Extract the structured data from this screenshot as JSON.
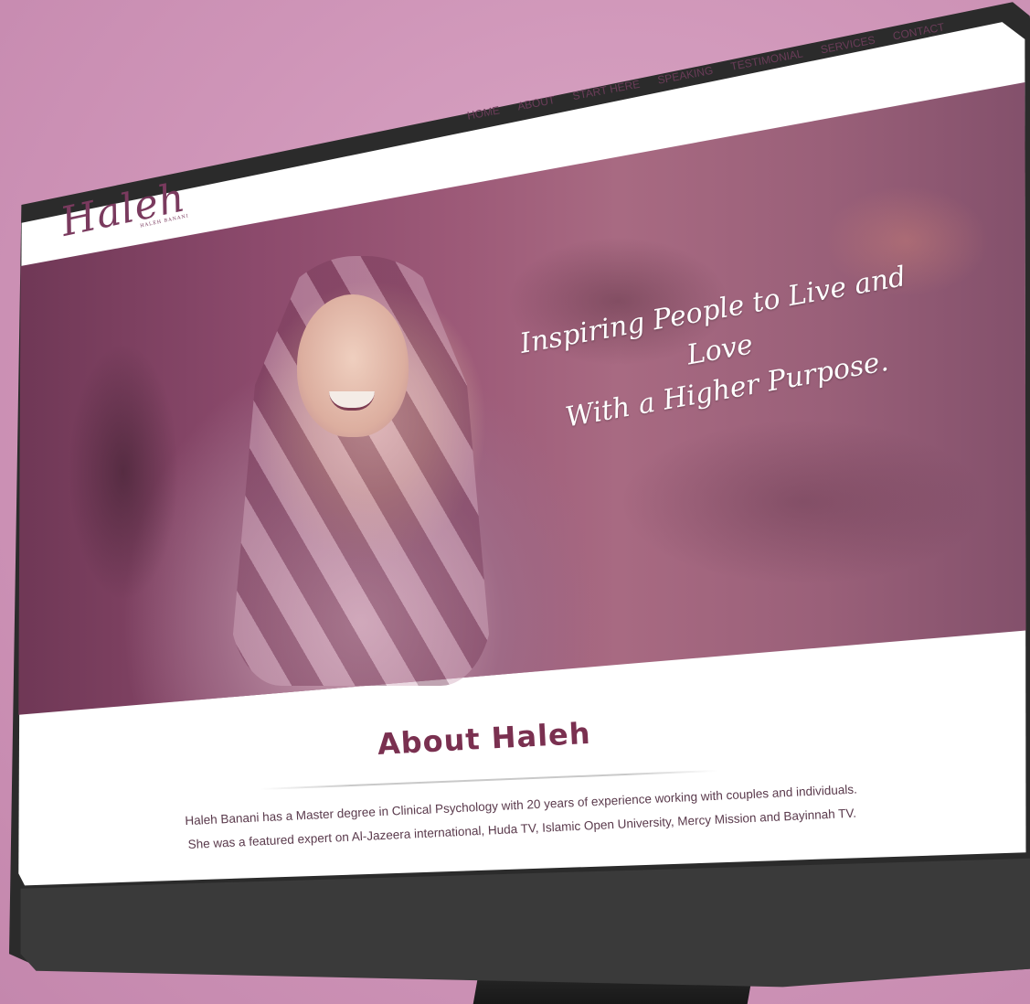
{
  "site": {
    "logo_text": "Haleh",
    "logo_subtext": "HALEH BANANI"
  },
  "nav": {
    "items": [
      {
        "label": "HOME"
      },
      {
        "label": "ABOUT"
      },
      {
        "label": "START HERE"
      },
      {
        "label": "SPEAKING"
      },
      {
        "label": "TESTIMONIAL"
      },
      {
        "label": "SERVICES"
      },
      {
        "label": "CONTACT"
      }
    ]
  },
  "hero": {
    "tagline_line1": "Inspiring People to Live and Love",
    "tagline_line2": "With a Higher Purpose."
  },
  "about": {
    "title": "About Haleh",
    "text_line1": "Haleh Banani has a Master degree in Clinical Psychology with 20 years of experience working with couples and individuals.",
    "text_line2": "She was a featured expert on Al-Jazeera international, Huda TV, Islamic Open University, Mercy Mission and Bayinnah TV."
  },
  "colors": {
    "background": "#d29bbd",
    "brand": "#7a3050",
    "hero_overlay": "#8c4a6c",
    "bezel": "#2b2b2b"
  }
}
